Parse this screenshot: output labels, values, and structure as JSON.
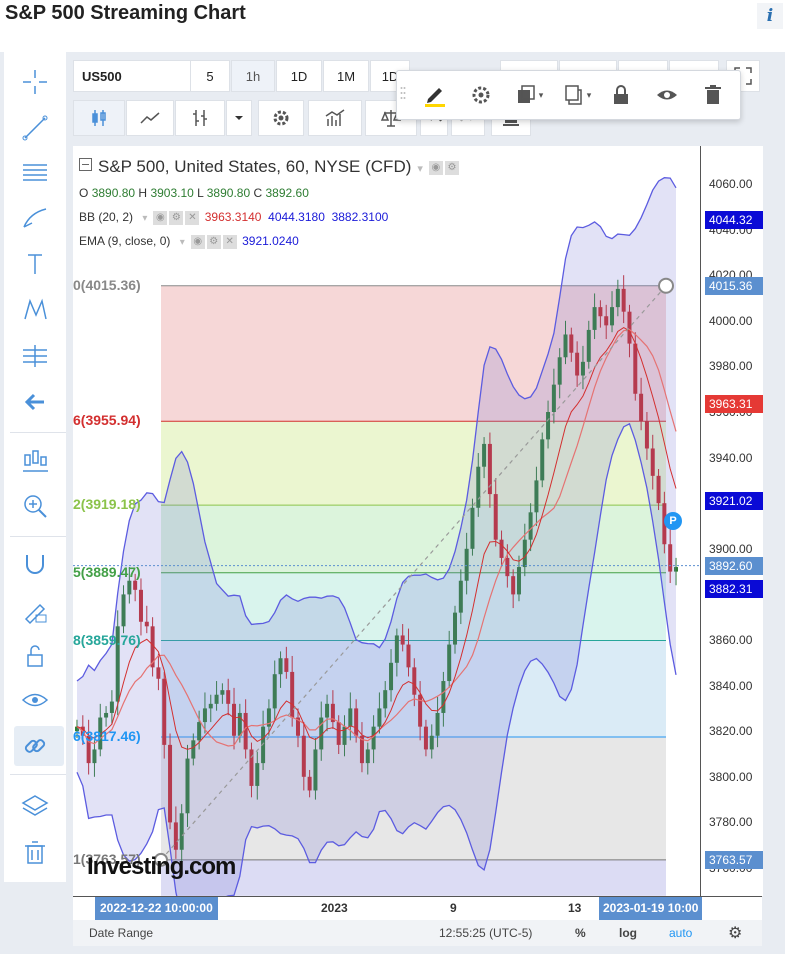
{
  "page": {
    "title": "S&P 500 Streaming Chart",
    "info_glyph": "i"
  },
  "toolbar": {
    "symbol": "US500",
    "intervals": [
      "5",
      "1h",
      "1D",
      "1M",
      "1D"
    ],
    "active_interval": "1h"
  },
  "legend": {
    "title": "S&P 500, United States, 60, NYSE (CFD)",
    "ohlc": {
      "o_label": "O",
      "o": "3890.80",
      "h_label": "H",
      "h": "3903.10",
      "l_label": "L",
      "l": "3890.80",
      "c_label": "C",
      "c": "3892.60"
    },
    "bb": {
      "label": "BB (20, 2)",
      "v1": "3963.3140",
      "v2": "4044.3180",
      "v3": "3882.3100"
    },
    "ema": {
      "label": "EMA (9, close, 0)",
      "v1": "3921.0240"
    }
  },
  "fib_levels": [
    {
      "label": "0(4015.36)",
      "value": 4015.36,
      "color": "#888888",
      "fill": "#f4d0d0"
    },
    {
      "label": "6(3955.94)",
      "value": 3955.94,
      "color": "#d32f2f",
      "fill": "#e8f4c8"
    },
    {
      "label": "2(3919.18)",
      "value": 3919.18,
      "color": "#8bc34a",
      "fill": "#d6f2d6"
    },
    {
      "label": "5(3889.47)",
      "value": 3889.47,
      "color": "#43a047",
      "fill": "#d2f2ea"
    },
    {
      "label": "8(3859.76)",
      "value": 3859.76,
      "color": "#26a69a",
      "fill": "#d4e8f5"
    },
    {
      "label": "6(3817.46)",
      "value": 3817.46,
      "color": "#2196f3",
      "fill": "#e3e3e3"
    },
    {
      "label": "1(3763.57)",
      "value": 3763.57,
      "color": "#777777",
      "fill": "#d6d6f2"
    }
  ],
  "price_axis": {
    "ticks": [
      "4060.00",
      "4040.00",
      "4020.00",
      "4000.00",
      "3980.00",
      "3960.00",
      "3940.00",
      "3920.00",
      "3900.00",
      "3880.00",
      "3860.00",
      "3840.00",
      "3820.00",
      "3800.00",
      "3780.00",
      "3760.00"
    ],
    "labels": [
      {
        "text": "4044.32",
        "color": "#0a0ad6"
      },
      {
        "text": "4015.36",
        "color": "#5b8fcf"
      },
      {
        "text": "3963.31",
        "color": "#e53935"
      },
      {
        "text": "3921.02",
        "color": "#0a0ad6"
      },
      {
        "text": "3892.60",
        "color": "#5b8fcf"
      },
      {
        "text": "3882.31",
        "color": "#0a0ad6"
      },
      {
        "text": "3763.57",
        "color": "#5b8fcf"
      }
    ]
  },
  "time_axis": {
    "start_label": "2022-12-22 10:00:00",
    "end_label": "2023-01-19 10:00",
    "labels": [
      "2023",
      "9",
      "13"
    ]
  },
  "status_bar": {
    "date_range": "Date Range",
    "time": "12:55:25",
    "timezone": "(UTC-5)",
    "percent": "%",
    "log": "log",
    "auto": "auto"
  },
  "watermark": "Investing.com",
  "marker": "P",
  "chart_data": {
    "type": "candlestick",
    "title": "S&P 500, United States, 60, NYSE (CFD)",
    "ylim": [
      3752,
      4068
    ],
    "yticks": [
      3760,
      3780,
      3800,
      3820,
      3840,
      3860,
      3880,
      3900,
      3920,
      3940,
      3960,
      3980,
      4000,
      4020,
      4040,
      4060
    ],
    "closes": [
      3822,
      3818,
      3806,
      3812,
      3826,
      3828,
      3833,
      3866,
      3880,
      3886,
      3882,
      3868,
      3866,
      3848,
      3843,
      3814,
      3780,
      3768,
      3784,
      3808,
      3816,
      3824,
      3830,
      3832,
      3836,
      3838,
      3832,
      3818,
      3828,
      3812,
      3796,
      3806,
      3822,
      3830,
      3845,
      3852,
      3846,
      3826,
      3818,
      3800,
      3794,
      3812,
      3826,
      3832,
      3824,
      3814,
      3822,
      3830,
      3818,
      3806,
      3812,
      3822,
      3830,
      3838,
      3850,
      3862,
      3858,
      3848,
      3836,
      3822,
      3812,
      3818,
      3828,
      3842,
      3858,
      3872,
      3886,
      3900,
      3918,
      3936,
      3946,
      3924,
      3904,
      3896,
      3888,
      3880,
      3892,
      3904,
      3916,
      3930,
      3948,
      3960,
      3972,
      3984,
      3994,
      3986,
      3976,
      3982,
      3996,
      4006,
      4002,
      3998,
      4006,
      4014,
      4004,
      3990,
      3968,
      3956,
      3944,
      3932,
      3920,
      3902,
      3890,
      3892
    ],
    "ema_last": 3921.024,
    "bb": {
      "upper": 4044.318,
      "middle": 3963.314,
      "lower": 3882.31
    }
  }
}
